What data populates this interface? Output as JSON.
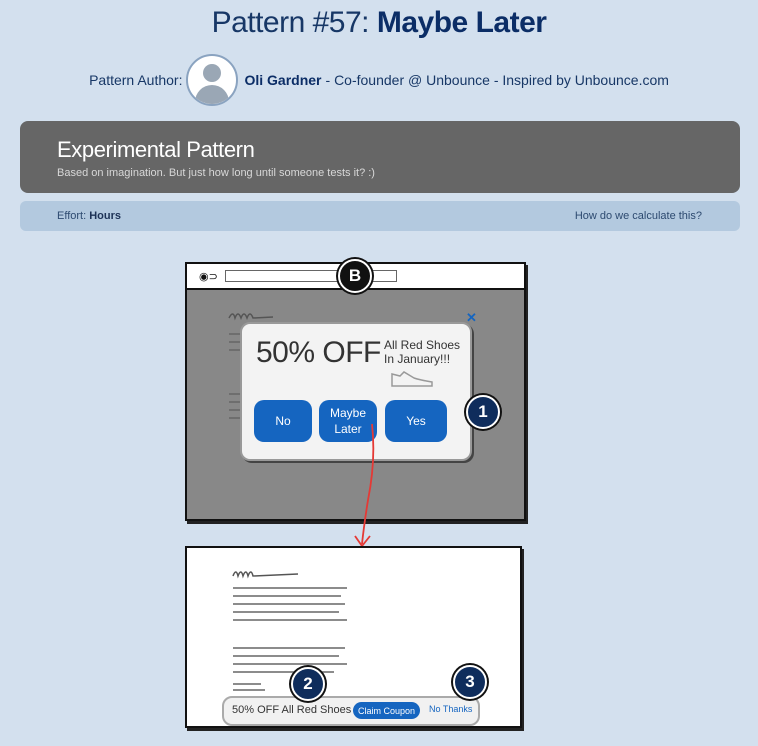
{
  "header": {
    "pattern_number": "Pattern #57:",
    "pattern_name": "Maybe Later",
    "author_label": "Pattern Author:",
    "author_name": "Oli Gardner",
    "author_suffix": "- Co-founder @ Unbounce - Inspired by Unbounce.com"
  },
  "banner": {
    "title": "Experimental Pattern",
    "subtitle": "Based on imagination. But just how long until someone tests it? :)"
  },
  "effort": {
    "label": "Effort:",
    "value": "Hours",
    "link": "How do we calculate this?"
  },
  "illustration": {
    "marker_b": "B",
    "modal": {
      "headline": "50% OFF",
      "text_line1": "All Red Shoes",
      "text_line2": "In January!!!",
      "buttons": [
        "No",
        "Maybe Later",
        "Yes"
      ]
    },
    "step_markers": [
      "1",
      "2",
      "3"
    ],
    "bottom_bar": {
      "text": "50% OFF All Red Shoes",
      "claim": "Claim Coupon",
      "dismiss": "No Thanks"
    }
  },
  "colors": {
    "background": "#d3e0ee",
    "accent": "#1565c0",
    "banner": "#666666",
    "heading": "#0b2d66"
  }
}
